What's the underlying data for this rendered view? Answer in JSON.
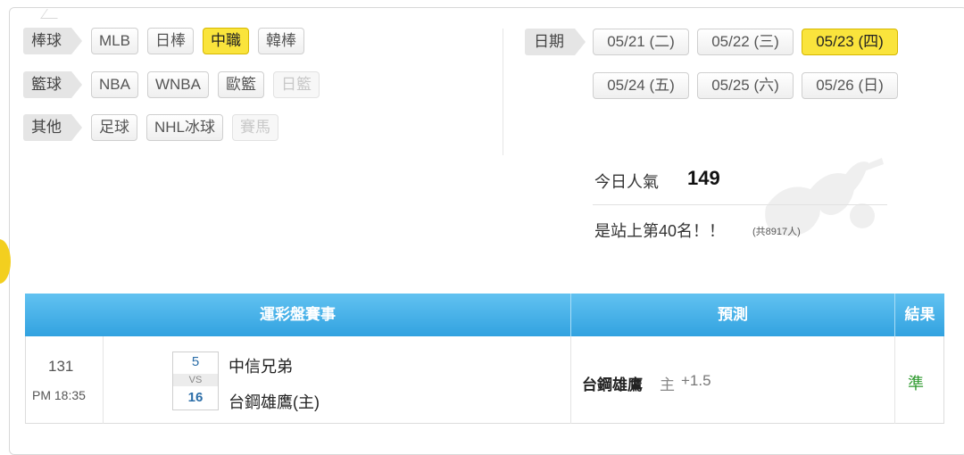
{
  "categories": [
    {
      "label": "棒球",
      "items": [
        {
          "label": "MLB",
          "state": "normal"
        },
        {
          "label": "日棒",
          "state": "normal"
        },
        {
          "label": "中職",
          "state": "active"
        },
        {
          "label": "韓棒",
          "state": "normal"
        }
      ]
    },
    {
      "label": "籃球",
      "items": [
        {
          "label": "NBA",
          "state": "normal"
        },
        {
          "label": "WNBA",
          "state": "normal"
        },
        {
          "label": "歐籃",
          "state": "normal"
        },
        {
          "label": "日籃",
          "state": "disabled"
        }
      ]
    },
    {
      "label": "其他",
      "items": [
        {
          "label": "足球",
          "state": "normal"
        },
        {
          "label": "NHL冰球",
          "state": "normal"
        },
        {
          "label": "賽馬",
          "state": "disabled"
        }
      ]
    }
  ],
  "dates": {
    "label": "日期",
    "items": [
      {
        "label": "05/21 (二)",
        "state": "normal"
      },
      {
        "label": "05/22 (三)",
        "state": "normal"
      },
      {
        "label": "05/23 (四)",
        "state": "active"
      },
      {
        "label": "05/24 (五)",
        "state": "normal"
      },
      {
        "label": "05/25 (六)",
        "state": "normal"
      },
      {
        "label": "05/26 (日)",
        "state": "normal"
      }
    ]
  },
  "popularity": {
    "label": "今日人氣",
    "value": "149",
    "rank_text": "是站上第40名！！",
    "total_text": "(共8917人)"
  },
  "table": {
    "headers": [
      "運彩盤賽事",
      "預測",
      "結果"
    ],
    "rows": [
      {
        "game_no": "131",
        "time": "PM 18:35",
        "away_score": "5",
        "vs": "VS",
        "home_score": "16",
        "away_team": "中信兄弟",
        "home_team": "台鋼雄鷹(主)",
        "prediction_team": "台鋼雄鷹",
        "prediction_side": "主",
        "prediction_line": "+1.5",
        "result": "準"
      }
    ]
  },
  "colors": {
    "accent_yellow": "#fae43c",
    "header_blue": "#32a2e0",
    "result_green": "#2f9a2f",
    "score_blue": "#2c6ea8"
  }
}
